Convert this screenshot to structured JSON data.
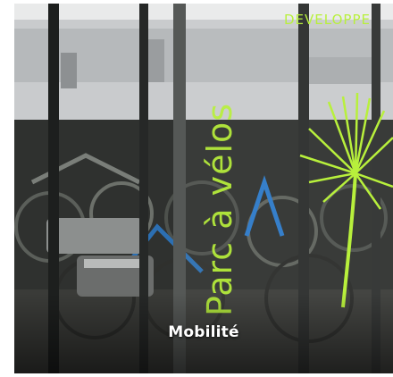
{
  "card": {
    "label": "Mobilité"
  },
  "photo": {
    "sign_vertical": "Parc à vélos",
    "sign_top": "DEVELOPPE",
    "colors": {
      "accent_green": "#b8f03c",
      "building": "#c9cbcd",
      "dark": "#1d1f1e"
    }
  }
}
